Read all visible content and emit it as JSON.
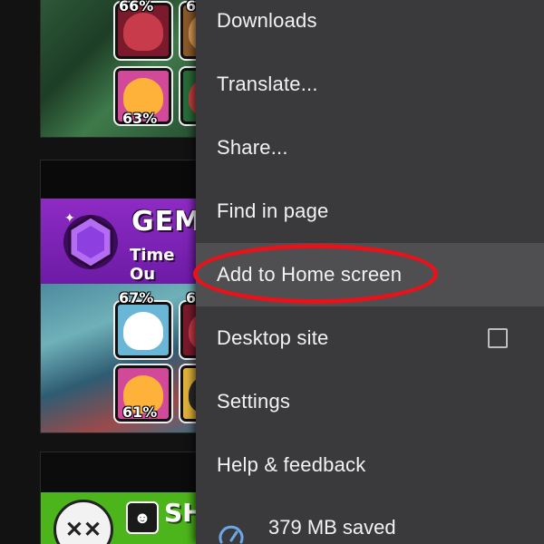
{
  "background_page": {
    "cards": [
      {
        "brawlers": [
          {
            "pct": "66%"
          },
          {
            "pct": "6"
          },
          {
            "pct": "63%"
          }
        ]
      },
      {
        "banner_title": "GEM",
        "banner_subtitle": "Time Ou",
        "brawlers": [
          {
            "pct": "67%"
          },
          {
            "pct": "6"
          },
          {
            "pct": "61%"
          }
        ]
      },
      {
        "banner_title": "SH"
      }
    ]
  },
  "menu": {
    "items": [
      {
        "label": "Downloads"
      },
      {
        "label": "Translate..."
      },
      {
        "label": "Share..."
      },
      {
        "label": "Find in page"
      },
      {
        "label": "Add to Home screen"
      },
      {
        "label": "Desktop site",
        "checked": false
      },
      {
        "label": "Settings"
      },
      {
        "label": "Help & feedback"
      }
    ],
    "data_saved": "379 MB saved"
  },
  "colors": {
    "menu_bg": "#3a3a3c",
    "highlight_bg": "#4f4f52",
    "annotation_ring": "#e8121a",
    "gem_banner": "#7d22b8",
    "green_banner": "#4cb51b"
  }
}
